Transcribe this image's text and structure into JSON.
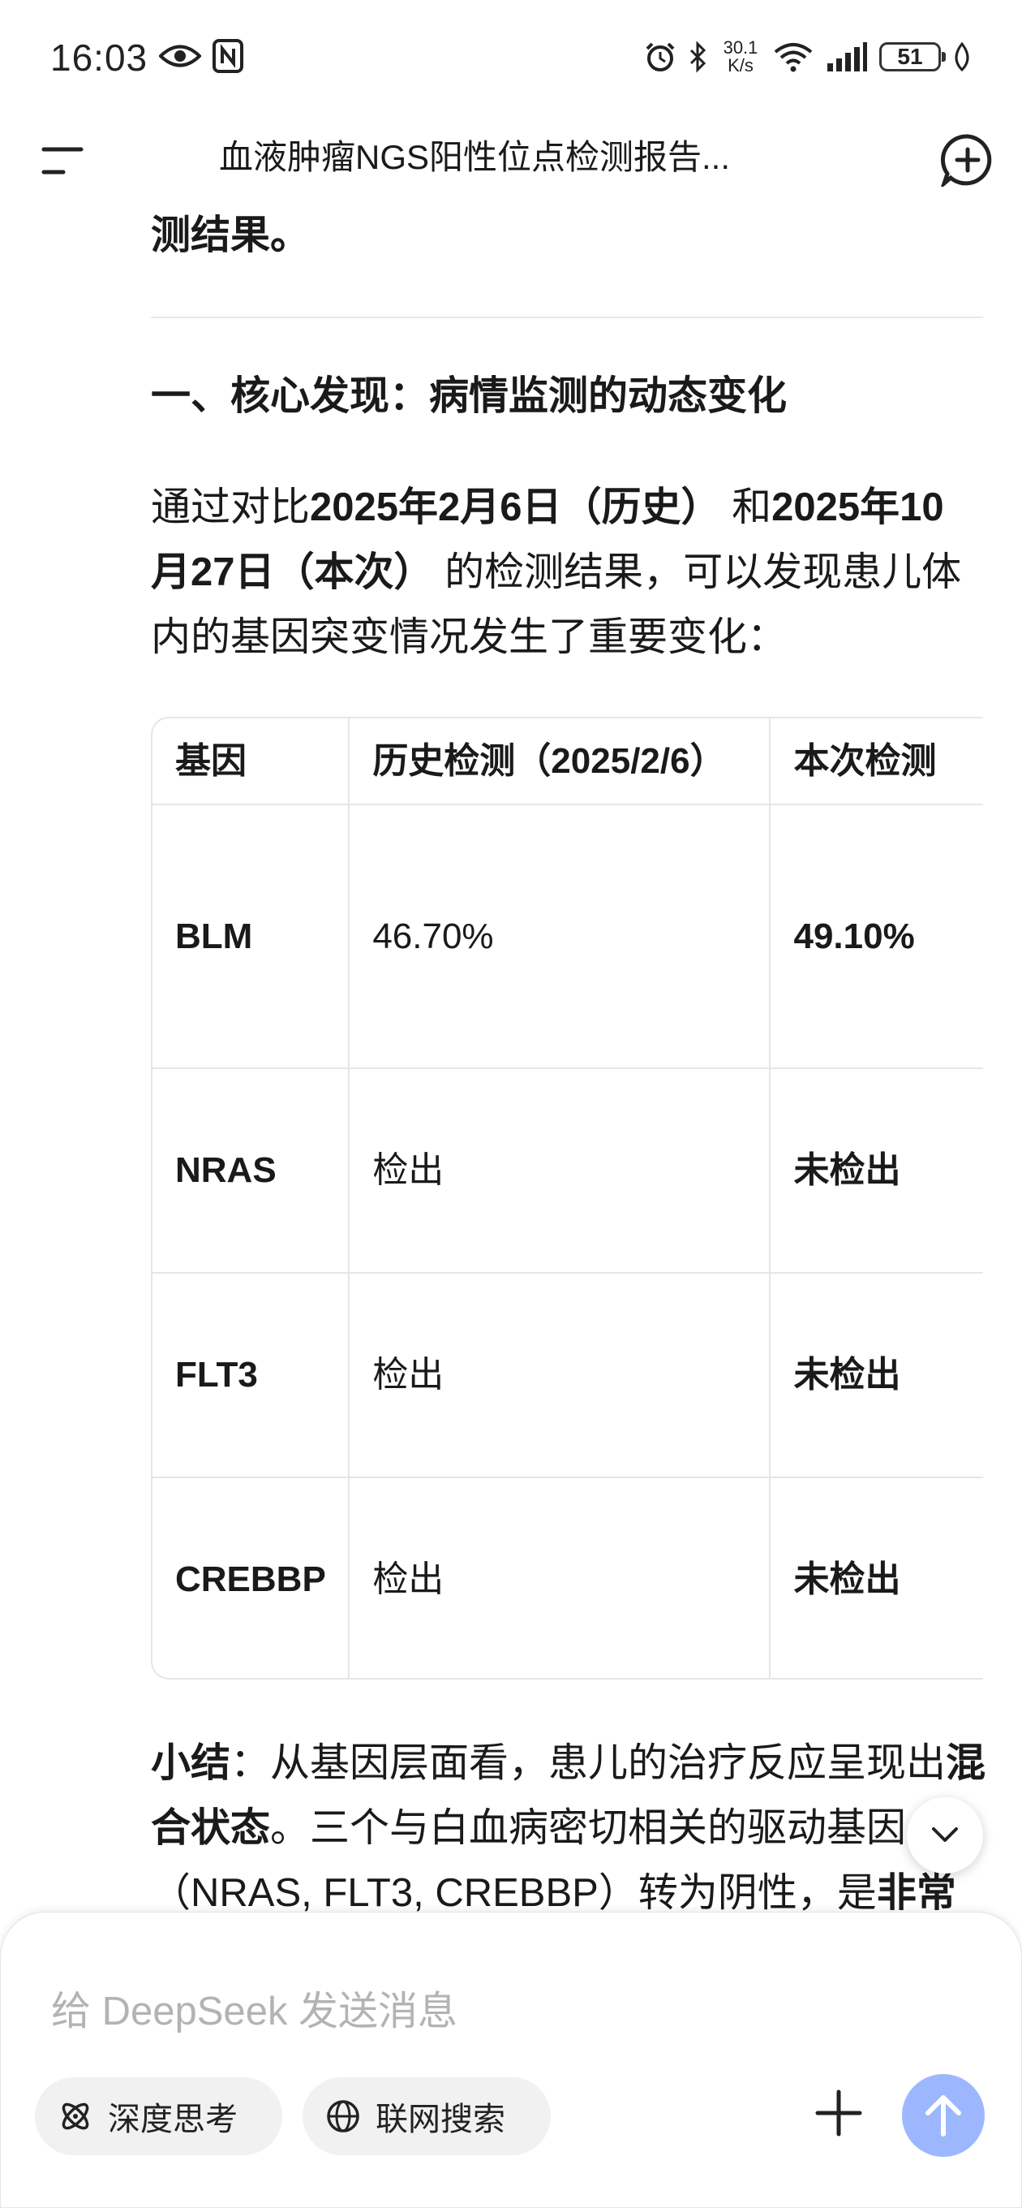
{
  "status_bar": {
    "time": "16:03",
    "net_speed_value": "30.1",
    "net_speed_unit": "K/s",
    "battery": "51"
  },
  "header": {
    "title": "血液肿瘤NGS阳性位点检测报告..."
  },
  "content": {
    "top_line": "测结果。",
    "section_heading": "一、核心发现：病情监测的动态变化",
    "intro": {
      "t1": "通过对比",
      "b1": "2025年2月6日（历史）",
      "t2": " 和",
      "b2": "2025年10月27日（本次）",
      "t3": " 的检测结果，可以发现患儿体内的基因突变情况发生了重要变化："
    },
    "table": {
      "headers": [
        "基因",
        "历史检测（2025/2/6）",
        "本次检测"
      ],
      "rows": [
        {
          "gene": "BLM",
          "history": "46.70%",
          "current": "49.10%"
        },
        {
          "gene": "NRAS",
          "history": "检出",
          "current": "未检出"
        },
        {
          "gene": "FLT3",
          "history": "检出",
          "current": "未检出"
        },
        {
          "gene": "CREBBP",
          "history": "检出",
          "current": "未检出"
        }
      ]
    },
    "summary": {
      "b1": "小结",
      "t1": "：从基因层面看，患儿的治疗反应呈现出",
      "b2": "混合状态",
      "t2": "。三个与白血病密切相关的驱动基因（NRAS, FLT3, CREBBP）转为阴性，是",
      "b3": "非常"
    }
  },
  "composer": {
    "placeholder": "给 DeepSeek 发送消息",
    "deep_think_label": "深度思考",
    "web_search_label": "联网搜索"
  },
  "colors": {
    "send_button": "#9db7ff",
    "pill_bg": "#f1f1f1"
  }
}
